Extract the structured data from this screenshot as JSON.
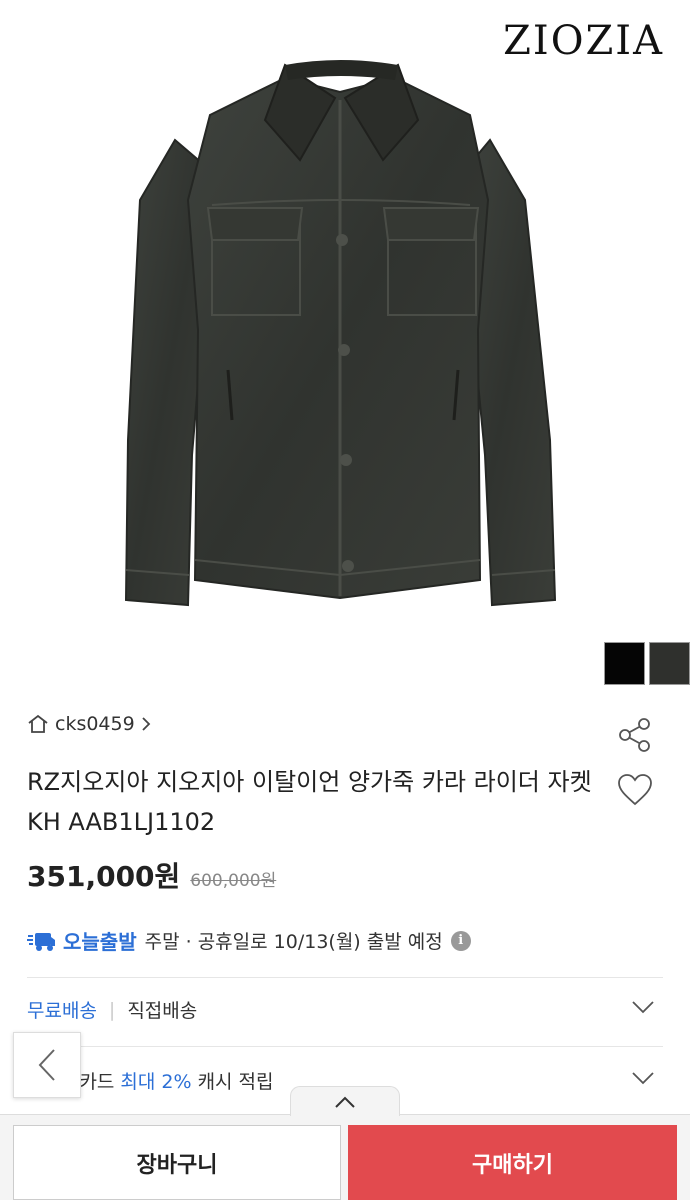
{
  "brand": {
    "logo_text": "ZIOZIA"
  },
  "swatches": [
    {
      "color": "#050505"
    },
    {
      "color": "#2f302d"
    }
  ],
  "seller": {
    "name": "cks0459"
  },
  "product": {
    "title": "RZ지오지아 지오지아 이탈이언 양가죽 카라 라이더 자켓 KH AAB1LJ1102",
    "sale_price": "351,000원",
    "original_price": "600,000원"
  },
  "shipping": {
    "badge": "오늘출발",
    "text": "주말 · 공휴일로 10/13(월) 출발 예정",
    "info": "i"
  },
  "delivery": {
    "free": "무료배송",
    "separator": "|",
    "direct": "직접배송"
  },
  "card": {
    "prefix": "스마일카드",
    "highlight": "최대 2%",
    "suffix": "캐시 적립"
  },
  "actions": {
    "cart": "장바구니",
    "buy": "구매하기"
  },
  "colors": {
    "accent_blue": "#2c6fd6",
    "buy_red": "#e24a4e"
  }
}
